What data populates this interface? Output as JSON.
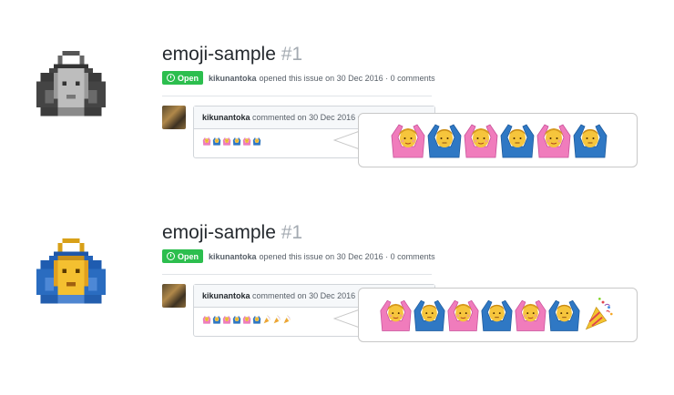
{
  "panels": [
    {
      "id": "top",
      "avatar_icon": "grayscale-pixel-person-icon",
      "issue": {
        "repo_title": "emoji-sample",
        "number": "#1",
        "badge": "Open",
        "author": "kikunantoka",
        "meta_text": "opened this issue on 30 Dec 2016 · 0 comments"
      },
      "comment": {
        "author": "kikunantoka",
        "meta_text": "commented on 30 Dec 2016 •",
        "emojis": [
          "woman-ok-gesture-icon",
          "man-ok-gesture-icon",
          "woman-ok-gesture-icon",
          "man-ok-gesture-icon",
          "woman-ok-gesture-icon",
          "man-ok-gesture-icon"
        ]
      },
      "callout_emojis": [
        "woman-ok-gesture-icon",
        "man-ok-gesture-icon",
        "woman-ok-gesture-icon",
        "man-ok-gesture-icon",
        "woman-ok-gesture-icon",
        "man-ok-gesture-icon"
      ]
    },
    {
      "id": "bottom",
      "avatar_icon": "color-pixel-person-icon",
      "issue": {
        "repo_title": "emoji-sample",
        "number": "#1",
        "badge": "Open",
        "author": "kikunantoka",
        "meta_text": "opened this issue on 30 Dec 2016 · 0 comments"
      },
      "comment": {
        "author": "kikunantoka",
        "meta_text": "commented on 30 Dec 2016 •",
        "emojis": [
          "woman-ok-gesture-icon",
          "man-ok-gesture-icon",
          "woman-ok-gesture-icon",
          "man-ok-gesture-icon",
          "woman-ok-gesture-icon",
          "man-ok-gesture-icon",
          "party-popper-icon",
          "party-popper-icon",
          "party-popper-icon"
        ]
      },
      "callout_emojis": [
        "woman-ok-gesture-icon",
        "man-ok-gesture-icon",
        "woman-ok-gesture-icon",
        "man-ok-gesture-icon",
        "woman-ok-gesture-icon",
        "man-ok-gesture-icon",
        "party-popper-icon"
      ]
    }
  ],
  "colors": {
    "open_badge": "#2cbe4e",
    "woman_gesture_bg": "#f07cbc",
    "man_gesture_bg": "#2f78c4",
    "skin": "#f6c53c"
  }
}
